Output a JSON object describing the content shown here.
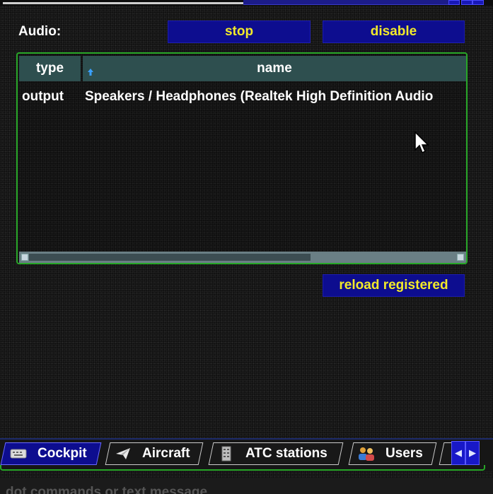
{
  "audio": {
    "label": "Audio:",
    "stop_label": "stop",
    "disable_label": "disable",
    "reload_label": "reload registered"
  },
  "table": {
    "columns": [
      "type",
      "name"
    ],
    "sorted_column": "name",
    "rows": [
      {
        "type": "output",
        "name": "Speakers / Headphones (Realtek High Definition Audio"
      }
    ]
  },
  "tabs": [
    {
      "label": "Cockpit",
      "icon": "keyboard-icon",
      "active": true
    },
    {
      "label": "Aircraft",
      "icon": "paper-plane-icon",
      "active": false
    },
    {
      "label": "ATC stations",
      "icon": "building-icon",
      "active": false
    },
    {
      "label": "Users",
      "icon": "users-icon",
      "active": false
    }
  ],
  "command_input": {
    "placeholder": "dot commands or text message"
  },
  "colors": {
    "button_bg": "#0d0d8f",
    "button_text": "#f2ea2a",
    "table_header_bg": "#2e4f4f",
    "frame_border": "#27a627",
    "background": "#121212"
  }
}
